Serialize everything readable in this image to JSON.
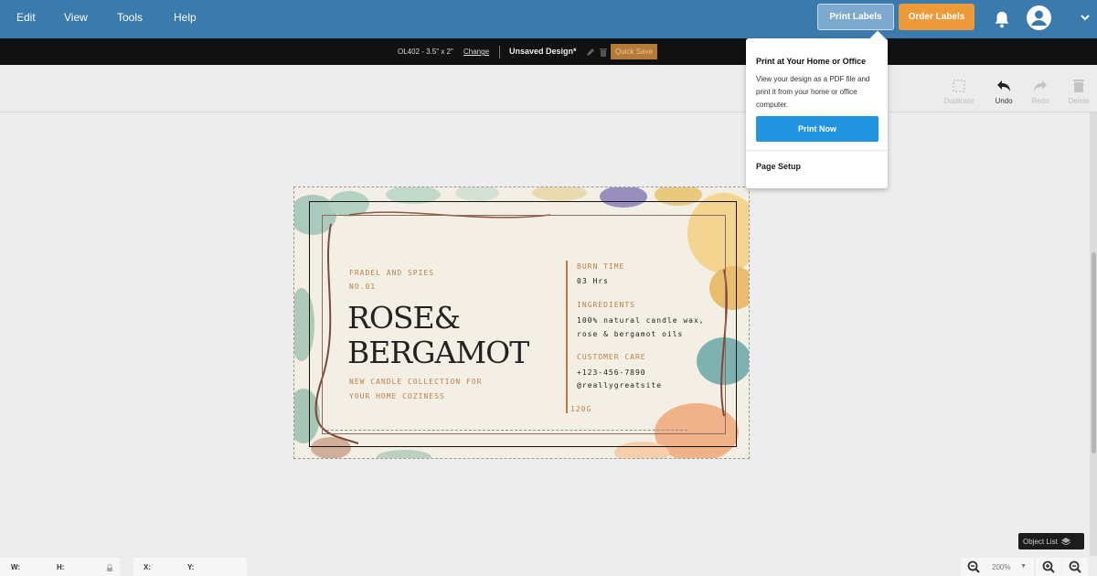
{
  "menu": {
    "edit": "Edit",
    "view": "View",
    "tools": "Tools",
    "help": "Help"
  },
  "header": {
    "print_labels": "Print Labels",
    "order_labels": "Order Labels"
  },
  "infobar": {
    "template": "OL402 - 3.5\" x 2\"",
    "change": "Change",
    "design_name": "Unsaved Design*",
    "quick_save": "Quick Save"
  },
  "toolbar": {
    "duplicate": "Duplicate",
    "undo": "Undo",
    "redo": "Redo",
    "delete": "Delete"
  },
  "label": {
    "brand": "FRADEL AND SPIES",
    "number": "NO.01",
    "title_line1": "ROSE&",
    "title_line2": "BERGAMOT",
    "tagline1": "NEW CANDLE COLLECTION FOR",
    "tagline2": "YOUR HOME COZINESS",
    "burn_time_label": "BURN TIME",
    "burn_time_value": "03 Hrs",
    "ingredients_label": "INGREDIENTS",
    "ingredients_line1": "100% natural candle wax,",
    "ingredients_line2": "rose & bergamot oils",
    "care_label": "CUSTOMER CARE",
    "phone": "+123-456-7890",
    "site": "@reallygreatsite",
    "weight": "120G"
  },
  "popup": {
    "heading": "Print at Your Home or Office",
    "body": "View your design as a PDF file and print it from your home or office computer.",
    "print_now": "Print Now",
    "page_setup": "Page Setup"
  },
  "object_list": "Object List",
  "status": {
    "w": "W:",
    "h": "H:",
    "x": "X:",
    "y": "Y:",
    "zoom": "200%"
  },
  "colors": {
    "topbar": "#3a7aad",
    "order": "#ec9a3a",
    "print_now": "#2295e0",
    "accent_brown": "#b9804a"
  }
}
